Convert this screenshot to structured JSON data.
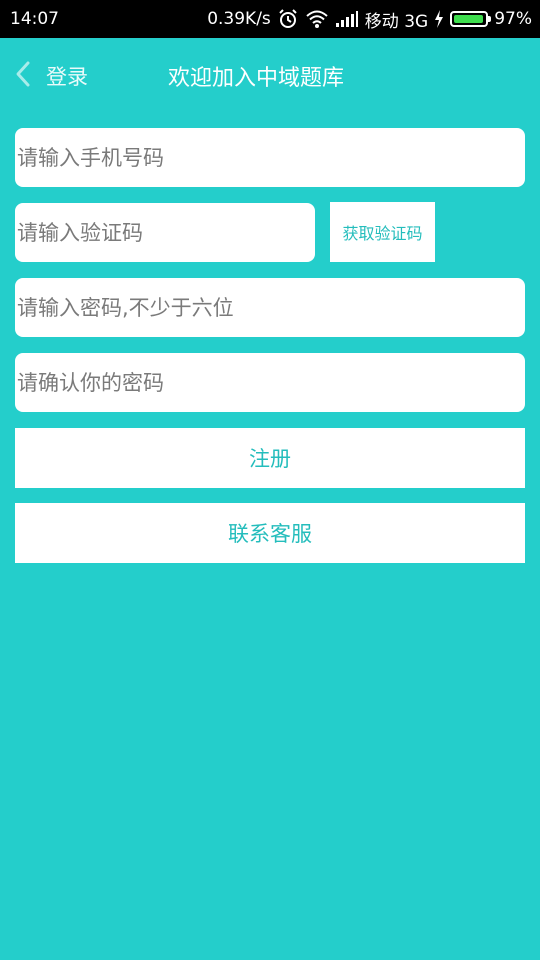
{
  "status_bar": {
    "time": "14:07",
    "speed": "0.39K/s",
    "carrier": "移动 3G",
    "battery": "97%",
    "battery_level": 0.97,
    "icons": [
      "alarm-icon",
      "wifi-icon",
      "signal-icon",
      "charging-icon",
      "battery-icon"
    ]
  },
  "header": {
    "back_label": "登录",
    "title": "欢迎加入中域题库"
  },
  "form": {
    "phone_placeholder": "请输入手机号码",
    "code_placeholder": "请输入验证码",
    "get_code_label": "获取验证码",
    "password_placeholder": "请输入密码,不少于六位",
    "confirm_placeholder": "请确认你的密码"
  },
  "actions": {
    "register_label": "注册",
    "contact_label": "联系客服"
  },
  "colors": {
    "background": "#24cecb",
    "accent_text": "#24bdbc"
  }
}
